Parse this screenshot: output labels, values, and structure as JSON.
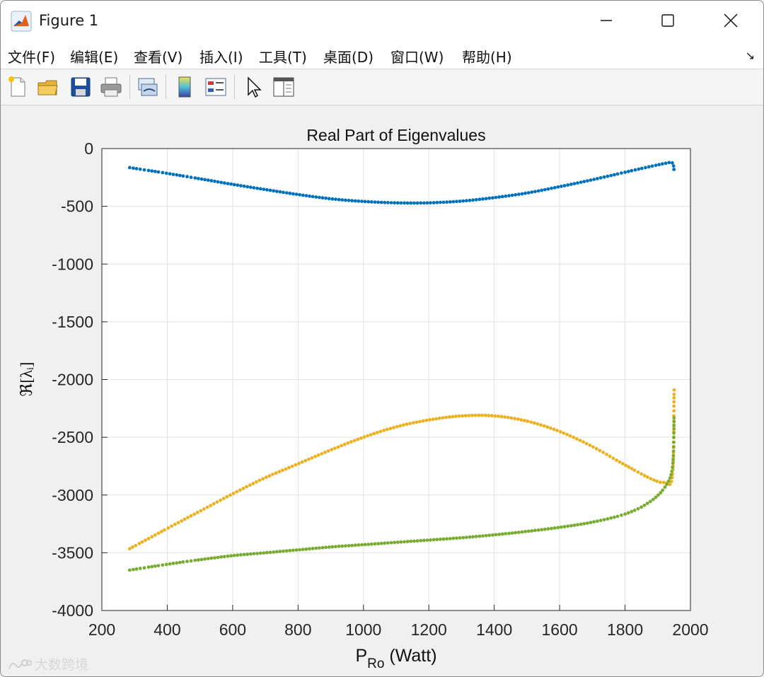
{
  "window": {
    "title": "Figure 1",
    "controls": {
      "minimize": "—",
      "maximize": "☐",
      "close": "✕"
    }
  },
  "menu": {
    "items": [
      "文件(F)",
      "编辑(E)",
      "查看(V)",
      "插入(I)",
      "工具(T)",
      "桌面(D)",
      "窗口(W)",
      "帮助(H)"
    ],
    "overflow_icon": "↘"
  },
  "toolbar": {
    "icons": [
      "new-figure-icon",
      "open-file-icon",
      "save-icon",
      "print-icon",
      "link-plot-icon",
      "colorbar-icon",
      "legend-icon",
      "pointer-icon",
      "property-editor-icon"
    ]
  },
  "watermark": {
    "text": "大数跨境"
  },
  "chart_data": {
    "type": "scatter",
    "title": "Real Part of Eigenvalues",
    "xlabel": {
      "main": "P",
      "sub": "Ro",
      "rest": " (Watt)"
    },
    "ylabel": "ℜ[λᵢ]",
    "xlim": [
      200,
      2000
    ],
    "ylim": [
      -4000,
      0
    ],
    "xticks": [
      200,
      400,
      600,
      800,
      1000,
      1200,
      1400,
      1600,
      1800,
      2000
    ],
    "yticks": [
      0,
      -500,
      -1000,
      -1500,
      -2000,
      -2500,
      -3000,
      -3500,
      -4000
    ],
    "grid": true,
    "series": [
      {
        "color": "#0072BD",
        "points": [
          [
            285,
            -165
          ],
          [
            400,
            -215
          ],
          [
            500,
            -262
          ],
          [
            600,
            -310
          ],
          [
            700,
            -355
          ],
          [
            800,
            -398
          ],
          [
            900,
            -435
          ],
          [
            1000,
            -458
          ],
          [
            1100,
            -470
          ],
          [
            1200,
            -470
          ],
          [
            1300,
            -455
          ],
          [
            1400,
            -425
          ],
          [
            1500,
            -385
          ],
          [
            1600,
            -330
          ],
          [
            1700,
            -270
          ],
          [
            1800,
            -205
          ],
          [
            1870,
            -160
          ],
          [
            1920,
            -130
          ],
          [
            1945,
            -125
          ],
          [
            1950,
            -200
          ]
        ]
      },
      {
        "color": "#EDB120",
        "points": [
          [
            285,
            -3465
          ],
          [
            400,
            -3290
          ],
          [
            500,
            -3140
          ],
          [
            600,
            -2990
          ],
          [
            700,
            -2850
          ],
          [
            800,
            -2730
          ],
          [
            900,
            -2610
          ],
          [
            1000,
            -2500
          ],
          [
            1100,
            -2410
          ],
          [
            1200,
            -2350
          ],
          [
            1300,
            -2315
          ],
          [
            1400,
            -2315
          ],
          [
            1500,
            -2360
          ],
          [
            1600,
            -2450
          ],
          [
            1700,
            -2580
          ],
          [
            1800,
            -2740
          ],
          [
            1880,
            -2860
          ],
          [
            1920,
            -2890
          ],
          [
            1945,
            -2830
          ],
          [
            1950,
            -2080
          ]
        ]
      },
      {
        "color": "#77AC30",
        "points": [
          [
            285,
            -3650
          ],
          [
            400,
            -3600
          ],
          [
            500,
            -3560
          ],
          [
            600,
            -3525
          ],
          [
            700,
            -3500
          ],
          [
            800,
            -3475
          ],
          [
            900,
            -3450
          ],
          [
            1000,
            -3430
          ],
          [
            1100,
            -3410
          ],
          [
            1200,
            -3390
          ],
          [
            1300,
            -3370
          ],
          [
            1400,
            -3345
          ],
          [
            1500,
            -3315
          ],
          [
            1600,
            -3280
          ],
          [
            1700,
            -3235
          ],
          [
            1800,
            -3165
          ],
          [
            1870,
            -3070
          ],
          [
            1920,
            -2940
          ],
          [
            1945,
            -2760
          ],
          [
            1950,
            -2320
          ]
        ]
      }
    ]
  }
}
